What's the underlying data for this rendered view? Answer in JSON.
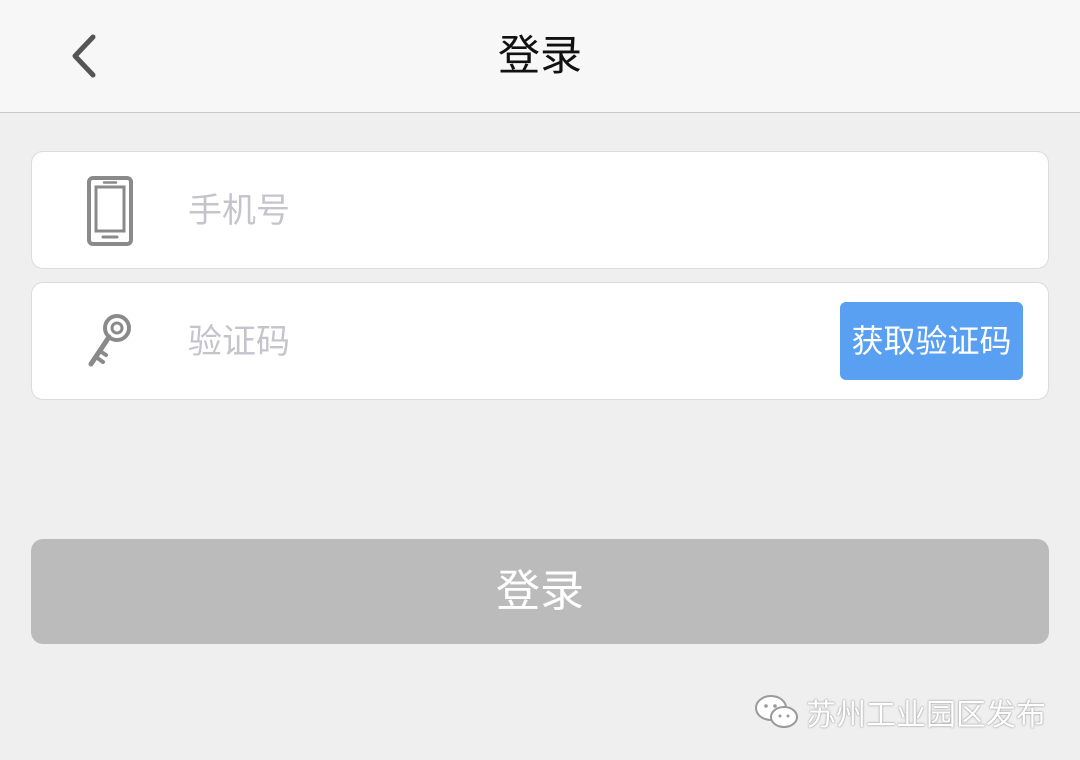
{
  "header": {
    "title": "登录",
    "back_icon": "chevron-left-icon"
  },
  "form": {
    "phone": {
      "icon": "mobile-phone-icon",
      "placeholder": "手机号",
      "value": ""
    },
    "code": {
      "icon": "key-icon",
      "placeholder": "验证码",
      "value": "",
      "get_code_label": "获取验证码"
    },
    "login_label": "登录"
  },
  "watermark": {
    "icon": "wechat-icon",
    "text": "苏州工业园区发布"
  },
  "colors": {
    "background": "#efefef",
    "header_background": "#f7f7f7",
    "get_code_button": "#5aa0f2",
    "login_button_disabled": "#bbbbbb",
    "placeholder": "#c4c4cc"
  }
}
